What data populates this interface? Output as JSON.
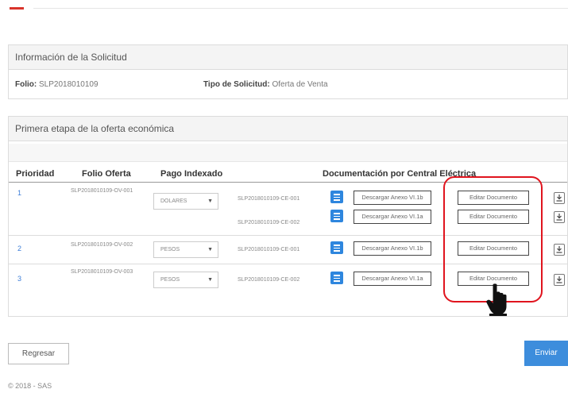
{
  "request_info": {
    "title": "Información de la Solicitud",
    "folio_label": "Folio:",
    "folio_value": "SLP2018010109",
    "tipo_label": "Tipo de Solicitud:",
    "tipo_value": "Oferta de Venta"
  },
  "offer_stage": {
    "title": "Primera etapa de la oferta económica",
    "columns": {
      "prioridad": "Prioridad",
      "folio_oferta": "Folio Oferta",
      "pago_indexado": "Pago Indexado",
      "documentacion": "Documentación por Central Eléctrica"
    },
    "rows": [
      {
        "priority": "1",
        "folio": "SLP2018010109-OV-001",
        "currency": "DOLARES",
        "docs": [
          {
            "central": "SLP2018010109-CE-001",
            "download": "Descargar Anexo VI.1b",
            "edit": "Editar Documento"
          },
          {
            "central": "SLP2018010109-CE-002",
            "download": "Descargar Anexo VI.1a",
            "edit": "Editar Documento"
          }
        ]
      },
      {
        "priority": "2",
        "folio": "SLP2018010109-OV-002",
        "currency": "PESOS",
        "docs": [
          {
            "central": "SLP2018010109-CE-001",
            "download": "Descargar Anexo VI.1b",
            "edit": "Editar Documento"
          }
        ]
      },
      {
        "priority": "3",
        "folio": "SLP2018010109-OV-003",
        "currency": "PESOS",
        "docs": [
          {
            "central": "SLP2018010109-CE-002",
            "download": "Descargar Anexo VI.1a",
            "edit": "Editar Documento"
          }
        ]
      }
    ]
  },
  "actions": {
    "back": "Regresar",
    "send": "Enviar"
  },
  "footer": "© 2018 - SAS",
  "colors": {
    "accent": "#d9342b",
    "primary": "#3d8ddc",
    "highlight": "#e0141e"
  }
}
